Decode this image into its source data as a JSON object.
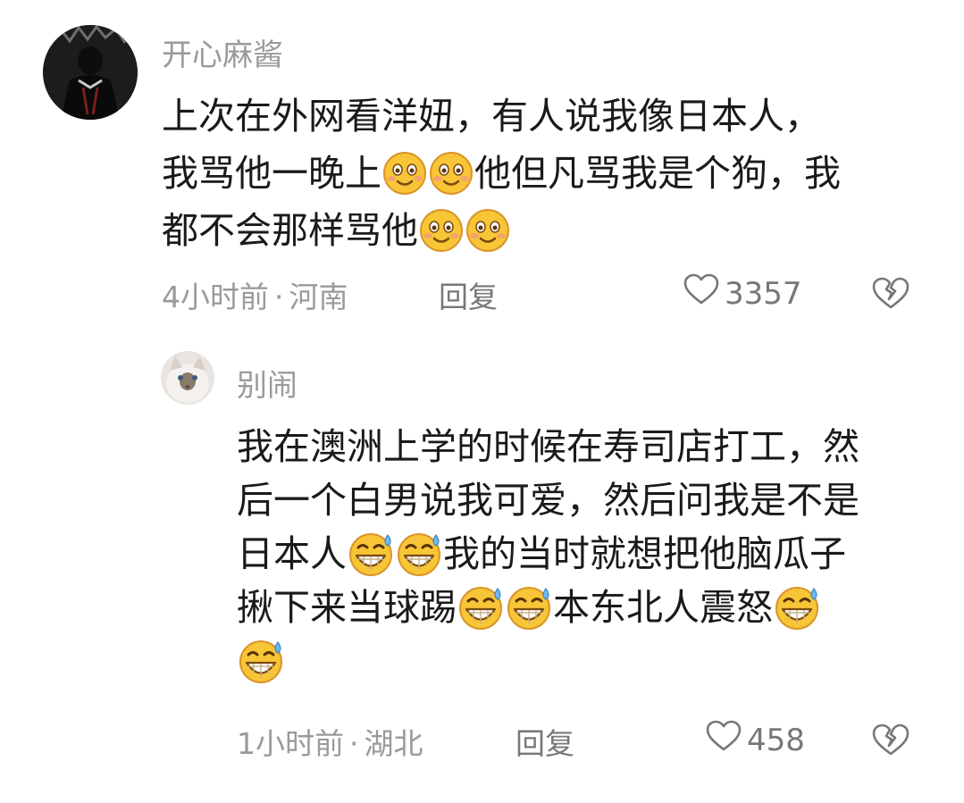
{
  "comments": [
    {
      "username": "开心麻酱",
      "lines": [
        {
          "parts": [
            "上次在外网看洋妞，有人说我像日本人，"
          ]
        },
        {
          "parts": [
            "我骂他一晚上",
            "",
            "他但凡骂我是个狗，我"
          ]
        },
        {
          "parts": [
            "都不会那样骂他",
            ""
          ]
        }
      ],
      "time": "4小时前",
      "separator": "·",
      "location": "河南",
      "reply_label": "回复",
      "likes": "3357",
      "emoji": "smile-blush-emoji",
      "avatar_icon": "dark-figure-avatar"
    },
    {
      "username": "别闹",
      "lines": [
        {
          "parts": [
            "我在澳洲上学的时候在寿司店打工，然"
          ]
        },
        {
          "parts": [
            "后一个白男说我可爱，然后问我是不是"
          ]
        },
        {
          "parts": [
            "日本人",
            "",
            "我的当时就想把他脑瓜子"
          ]
        },
        {
          "parts": [
            "揪下来当球踢",
            "",
            "本东北人震怒",
            ""
          ]
        },
        {
          "parts": [
            ""
          ]
        }
      ],
      "time": "1小时前",
      "separator": "·",
      "location": "湖北",
      "reply_label": "回复",
      "likes": "458",
      "emoji": "grin-sweat-emoji",
      "avatar_icon": "cat-avatar"
    }
  ],
  "colors": {
    "meta_text": "#9a9a9a",
    "body_text": "#1a1a1a",
    "emoji_face": "#f8c537"
  }
}
